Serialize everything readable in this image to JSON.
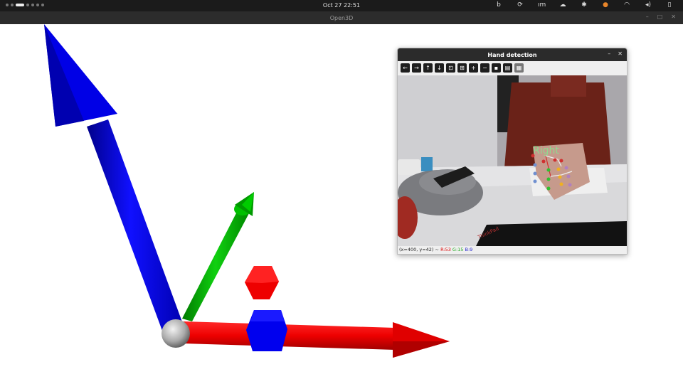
{
  "topbar": {
    "clock": "Oct 27  22:51",
    "tray_icons": [
      "bing-icon",
      "sync-icon",
      "im-icon",
      "cloud-icon",
      "accessibility-icon",
      "microphone-icon",
      "wifi-icon",
      "volume-icon",
      "battery-icon"
    ]
  },
  "open3d_window": {
    "title": "Open3D",
    "axes_colors": {
      "x": "#ff0000",
      "y": "#00cc00",
      "z": "#0000ff"
    },
    "sphere_color": "#aaaaaa",
    "markers": [
      {
        "shape": "hexagon",
        "color": "#ff0000"
      },
      {
        "shape": "hexagon",
        "color": "#0000ff"
      }
    ]
  },
  "hand_window": {
    "title": "Hand detection",
    "toolbar": [
      "arrow-left-icon",
      "arrow-right-icon",
      "arrow-up-icon",
      "arrow-down-icon",
      "zoom-fit-icon",
      "zoom-original-icon",
      "zoom-in-icon",
      "zoom-out-icon",
      "save-icon",
      "properties-icon",
      "settings-icon"
    ],
    "camera": {
      "hand_label": "Right",
      "laptop_brand": "ThinkPad"
    },
    "status": {
      "coords": "(x=400, y=42) ~",
      "r": "R:53",
      "g": "G:15",
      "b": "B:9"
    }
  }
}
